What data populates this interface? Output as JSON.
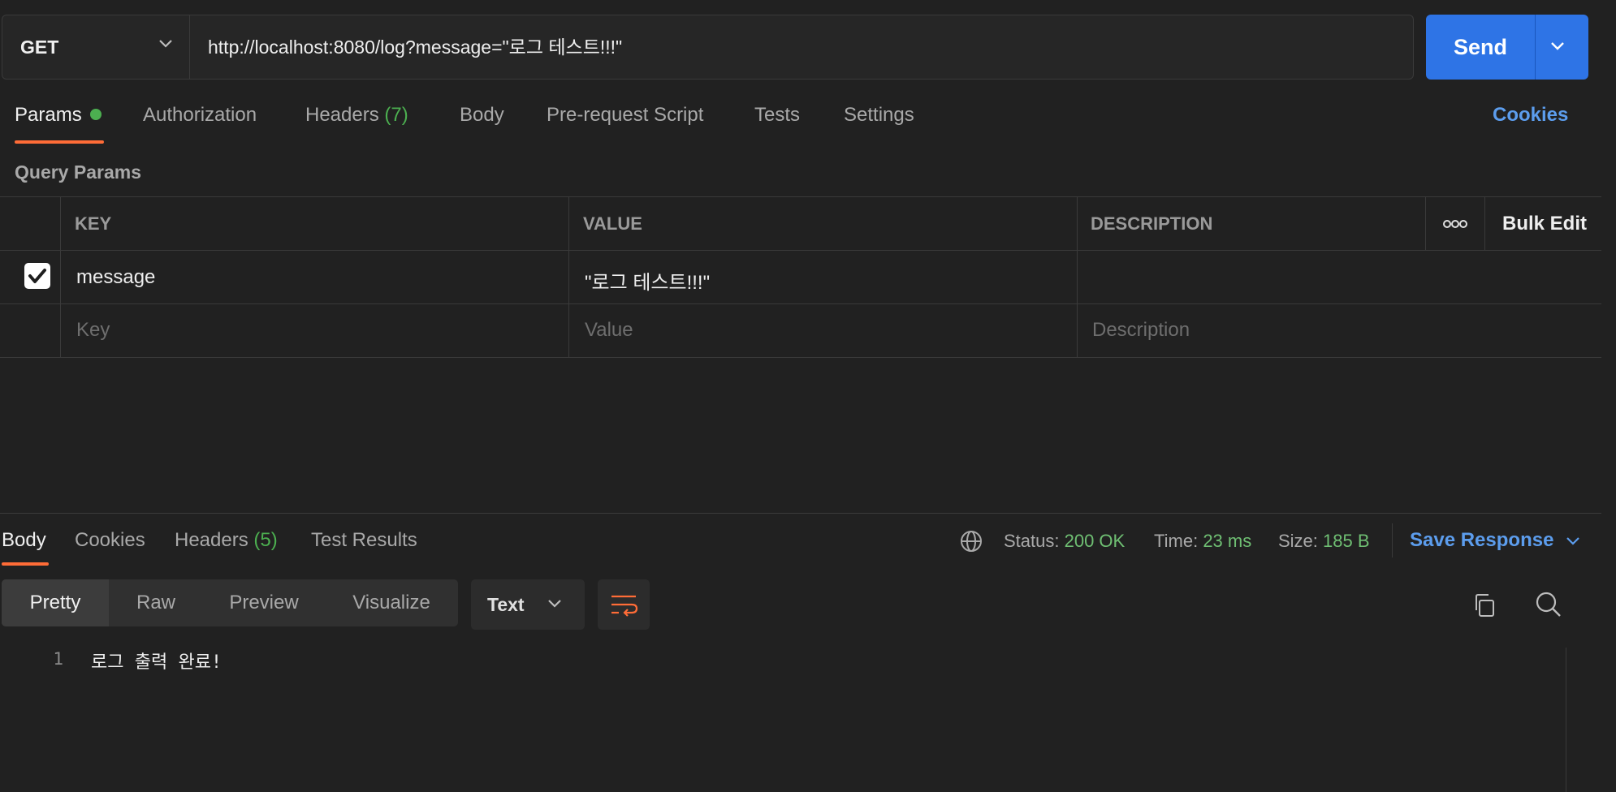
{
  "request": {
    "method": "GET",
    "url": "http://localhost:8080/log?message=\"로그 테스트!!!\"",
    "send_label": "Send"
  },
  "request_tabs": {
    "params": "Params",
    "authorization": "Authorization",
    "headers": "Headers",
    "headers_count": "(7)",
    "body": "Body",
    "prerequest": "Pre-request Script",
    "tests": "Tests",
    "settings": "Settings",
    "cookies": "Cookies"
  },
  "query_params": {
    "title": "Query Params",
    "columns": {
      "key": "KEY",
      "value": "VALUE",
      "description": "DESCRIPTION"
    },
    "bulk_edit": "Bulk Edit",
    "rows": [
      {
        "checked": true,
        "key": "message",
        "value": "\"로그 테스트!!!\"",
        "description": ""
      }
    ],
    "placeholders": {
      "key": "Key",
      "value": "Value",
      "description": "Description"
    }
  },
  "response": {
    "tabs": {
      "body": "Body",
      "cookies": "Cookies",
      "headers": "Headers",
      "headers_count": "(5)",
      "test_results": "Test Results"
    },
    "status_label": "Status:",
    "status_value": "200 OK",
    "time_label": "Time:",
    "time_value": "23 ms",
    "size_label": "Size:",
    "size_value": "185 B",
    "save_response": "Save Response",
    "view_modes": [
      "Pretty",
      "Raw",
      "Preview",
      "Visualize"
    ],
    "format": "Text",
    "lines": [
      {
        "number": "1",
        "text": "로그 출력 완료!"
      }
    ]
  },
  "colors": {
    "accent_blue": "#2e74e6",
    "link_blue": "#5c9ded",
    "active_orange": "#ff6c37",
    "status_green": "#6fbf73"
  }
}
